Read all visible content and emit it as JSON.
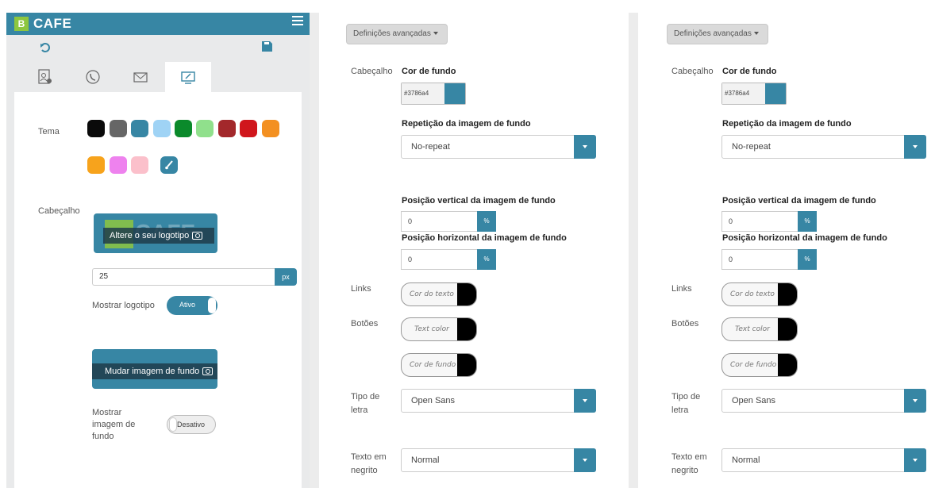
{
  "left_panel": {
    "brand": {
      "badge": "B",
      "name": "CAFE"
    },
    "tabs": [
      "profile-tab",
      "phone-tab",
      "mail-tab",
      "display-tab"
    ],
    "tema_label": "Tema",
    "theme_colors": [
      "#0a0a0a",
      "#666666",
      "#3786a4",
      "#9fd3f5",
      "#0b8a2b",
      "#90e08c",
      "#a3282b",
      "#d0161c",
      "#f39021",
      "#f7a31c",
      "#ee82ee",
      "#fbc0cb"
    ],
    "cabecalho_label": "Cabeçalho",
    "logo": {
      "ghost_badge": "B",
      "ghost_text": "CAFE",
      "overlay": "Altere o seu logotipo"
    },
    "logo_size": {
      "value": "25",
      "unit": "px"
    },
    "mostrar_logotipo": {
      "label": "Mostrar logotipo",
      "state": "Ativo"
    },
    "change_bg_label": "Mudar imagem de fundo",
    "mostrar_imagem": {
      "label_lines": [
        "Mostrar",
        "imagem de",
        "fundo"
      ],
      "state": "Desativo"
    }
  },
  "settings_panels": [
    {
      "advanced_label": "Definições avançadas",
      "cabecalho_label": "Cabeçalho",
      "cor_de_fundo": {
        "label": "Cor de fundo",
        "hex": "#3786a4"
      },
      "repeticao": {
        "label": "Repetição da imagem de fundo",
        "value": "No-repeat"
      },
      "pos_vertical": {
        "label": "Posição vertical da imagem de fundo",
        "value": "0",
        "unit": "%"
      },
      "pos_horizontal": {
        "label": "Posição horizontal da imagem de fundo",
        "value": "0",
        "unit": "%"
      },
      "links": {
        "label": "Links",
        "placeholder": "Cor do texto"
      },
      "botoes": {
        "label": "Botões",
        "text_placeholder": "Text color",
        "bg_placeholder": "Cor de fundo"
      },
      "tipo_letra": {
        "label_lines": [
          "Tipo de",
          "letra"
        ],
        "value": "Open Sans"
      },
      "texto_negrito": {
        "label_lines": [
          "Texto em",
          "negrito"
        ],
        "value": "Normal"
      }
    },
    {
      "advanced_label": "Definições avançadas",
      "cabecalho_label": "Cabeçalho",
      "cor_de_fundo": {
        "label": "Cor de fundo",
        "hex": "#3786a4"
      },
      "repeticao": {
        "label": "Repetição da imagem de fundo",
        "value": "No-repeat"
      },
      "pos_vertical": {
        "label": "Posição vertical da imagem de fundo",
        "value": "0",
        "unit": "%"
      },
      "pos_horizontal": {
        "label": "Posição horizontal da imagem de fundo",
        "value": "0",
        "unit": "%"
      },
      "links": {
        "label": "Links",
        "placeholder": "Cor do texto"
      },
      "botoes": {
        "label": "Botões",
        "text_placeholder": "Text color",
        "bg_placeholder": "Cor de fundo"
      },
      "tipo_letra": {
        "label_lines": [
          "Tipo de",
          "letra"
        ],
        "value": "Open Sans"
      },
      "texto_negrito": {
        "label_lines": [
          "Texto em",
          "negrito"
        ],
        "value": "Normal"
      }
    }
  ],
  "colors": {
    "accent": "#3786a4",
    "brand_green": "#8dc63f"
  }
}
